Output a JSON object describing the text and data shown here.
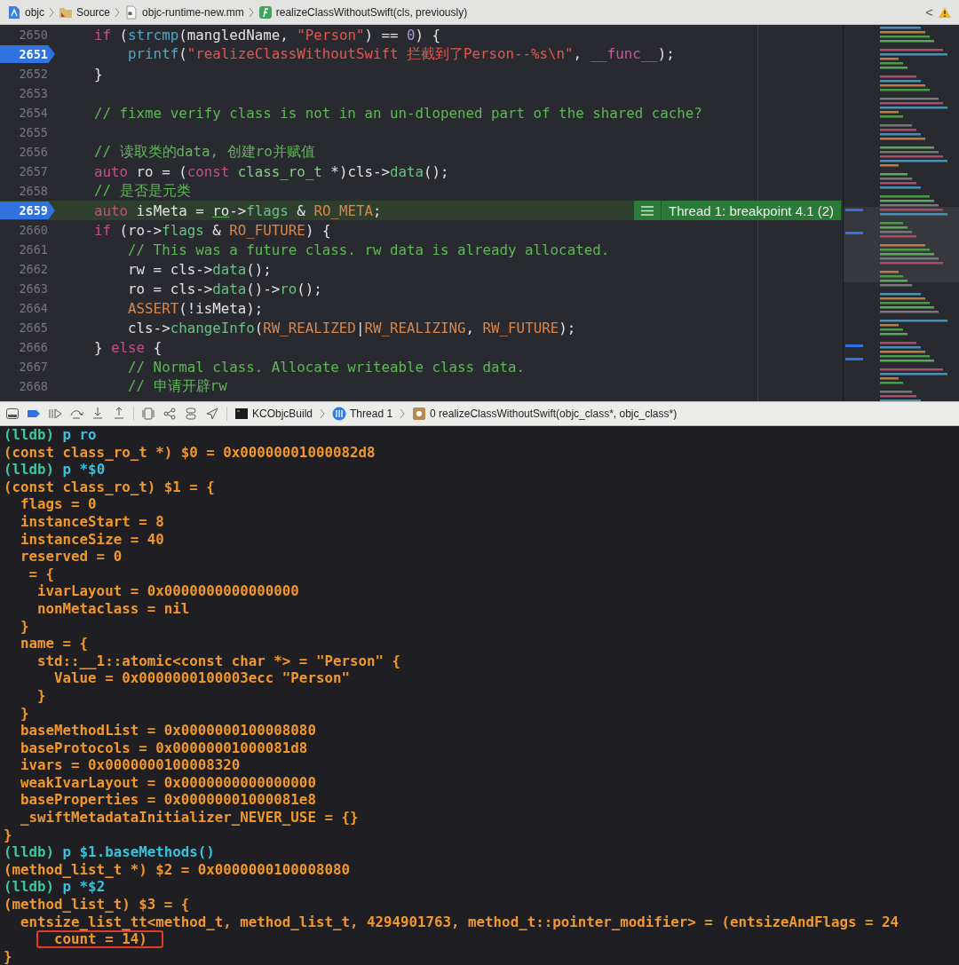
{
  "path_bar": {
    "items": [
      {
        "kind": "project",
        "label": "objc"
      },
      {
        "kind": "folder",
        "label": "Source"
      },
      {
        "kind": "file",
        "label": "objc-runtime-new.mm"
      },
      {
        "kind": "function",
        "label": "realizeClassWithoutSwift(cls, previously)"
      }
    ],
    "back": "<"
  },
  "editor": {
    "lines": [
      {
        "number": "2650",
        "breakpoint": false,
        "current": false,
        "tokens": [
          {
            "kind": "keyword",
            "text": "    if"
          },
          {
            "kind": "plain",
            "text": " ("
          },
          {
            "kind": "function",
            "text": "strcmp"
          },
          {
            "kind": "plain",
            "text": "(mangledName, "
          },
          {
            "kind": "string",
            "text": "\"Person\""
          },
          {
            "kind": "plain",
            "text": ") == "
          },
          {
            "kind": "number",
            "text": "0"
          },
          {
            "kind": "plain",
            "text": ") {"
          }
        ]
      },
      {
        "number": "2651",
        "breakpoint": true,
        "current": false,
        "tokens": [
          {
            "kind": "function",
            "text": "        printf"
          },
          {
            "kind": "plain",
            "text": "("
          },
          {
            "kind": "string",
            "text": "\"realizeClassWithoutSwift 拦截到了Person--%s\\n\""
          },
          {
            "kind": "plain",
            "text": ", "
          },
          {
            "kind": "macro_var",
            "text": "__func__"
          },
          {
            "kind": "plain",
            "text": ");"
          }
        ]
      },
      {
        "number": "2652",
        "breakpoint": false,
        "current": false,
        "tokens": [
          {
            "kind": "plain",
            "text": "    }"
          }
        ]
      },
      {
        "number": "2653",
        "breakpoint": false,
        "current": false
      },
      {
        "number": "2654",
        "breakpoint": false,
        "current": false,
        "tokens": [
          {
            "kind": "comment",
            "text": "    // fixme verify class is not in an un-dlopened part of the shared cache?"
          }
        ]
      },
      {
        "number": "2655",
        "breakpoint": false,
        "current": false
      },
      {
        "number": "2656",
        "breakpoint": false,
        "current": false,
        "tokens": [
          {
            "kind": "comment",
            "text": "    // 读取类的data, 创建ro并赋值"
          }
        ]
      },
      {
        "number": "2657",
        "breakpoint": false,
        "current": false,
        "tokens": [
          {
            "kind": "keyword",
            "text": "    auto"
          },
          {
            "kind": "plain",
            "text": " ro = ("
          },
          {
            "kind": "keyword",
            "text": "const"
          },
          {
            "kind": "type",
            "text": " class_ro_t"
          },
          {
            "kind": "plain",
            "text": " *)cls->"
          },
          {
            "kind": "method",
            "text": "data"
          },
          {
            "kind": "plain",
            "text": "();"
          }
        ]
      },
      {
        "number": "2658",
        "breakpoint": false,
        "current": false,
        "tokens": [
          {
            "kind": "comment",
            "text": "    // 是否是元类"
          }
        ]
      },
      {
        "number": "2659",
        "breakpoint": true,
        "current": true,
        "annotation": "Thread 1: breakpoint 4.1 (2)",
        "tokens": [
          {
            "kind": "keyword",
            "text": "    auto"
          },
          {
            "kind": "plain",
            "text": " isMeta = "
          },
          {
            "kind": "underlined",
            "text": "ro"
          },
          {
            "kind": "plain",
            "text": "->"
          },
          {
            "kind": "method",
            "text": "flags"
          },
          {
            "kind": "plain",
            "text": " & "
          },
          {
            "kind": "macro",
            "text": "RO_META"
          },
          {
            "kind": "plain",
            "text": ";"
          }
        ]
      },
      {
        "number": "2660",
        "breakpoint": false,
        "current": false,
        "tokens": [
          {
            "kind": "keyword",
            "text": "    if"
          },
          {
            "kind": "plain",
            "text": " (ro->"
          },
          {
            "kind": "method",
            "text": "flags"
          },
          {
            "kind": "plain",
            "text": " & "
          },
          {
            "kind": "macro",
            "text": "RO_FUTURE"
          },
          {
            "kind": "plain",
            "text": ") {"
          }
        ]
      },
      {
        "number": "2661",
        "breakpoint": false,
        "current": false,
        "tokens": [
          {
            "kind": "comment",
            "text": "        // This was a future class. rw data is already allocated."
          }
        ]
      },
      {
        "number": "2662",
        "breakpoint": false,
        "current": false,
        "tokens": [
          {
            "kind": "plain",
            "text": "        rw = cls->"
          },
          {
            "kind": "method",
            "text": "data"
          },
          {
            "kind": "plain",
            "text": "();"
          }
        ]
      },
      {
        "number": "2663",
        "breakpoint": false,
        "current": false,
        "tokens": [
          {
            "kind": "plain",
            "text": "        ro = cls->"
          },
          {
            "kind": "method",
            "text": "data"
          },
          {
            "kind": "plain",
            "text": "()->"
          },
          {
            "kind": "method",
            "text": "ro"
          },
          {
            "kind": "plain",
            "text": "();"
          }
        ]
      },
      {
        "number": "2664",
        "breakpoint": false,
        "current": false,
        "tokens": [
          {
            "kind": "macro",
            "text": "        ASSERT"
          },
          {
            "kind": "plain",
            "text": "(!isMeta);"
          }
        ]
      },
      {
        "number": "2665",
        "breakpoint": false,
        "current": false,
        "tokens": [
          {
            "kind": "plain",
            "text": "        cls->"
          },
          {
            "kind": "method",
            "text": "changeInfo"
          },
          {
            "kind": "plain",
            "text": "("
          },
          {
            "kind": "macro",
            "text": "RW_REALIZED"
          },
          {
            "kind": "plain",
            "text": "|"
          },
          {
            "kind": "macro",
            "text": "RW_REALIZING"
          },
          {
            "kind": "plain",
            "text": ", "
          },
          {
            "kind": "macro",
            "text": "RW_FUTURE"
          },
          {
            "kind": "plain",
            "text": ");"
          }
        ]
      },
      {
        "number": "2666",
        "breakpoint": false,
        "current": false,
        "tokens": [
          {
            "kind": "plain",
            "text": "    } "
          },
          {
            "kind": "keyword",
            "text": "else"
          },
          {
            "kind": "plain",
            "text": " {"
          }
        ]
      },
      {
        "number": "2667",
        "breakpoint": false,
        "current": false,
        "tokens": [
          {
            "kind": "comment",
            "text": "        // Normal class. Allocate writeable class data."
          }
        ]
      },
      {
        "number": "2668",
        "breakpoint": false,
        "current": false,
        "tokens": [
          {
            "kind": "comment",
            "text": "        // 申请开辟rw"
          }
        ]
      }
    ]
  },
  "debug_bar": {
    "tools": [
      {
        "kind": "console"
      },
      {
        "kind": "breakpoints"
      },
      {
        "kind": "continue"
      },
      {
        "kind": "step_over"
      },
      {
        "kind": "step_into"
      },
      {
        "kind": "step_out"
      },
      {
        "kind": "view_debugger"
      },
      {
        "kind": "memory_graph"
      },
      {
        "kind": "environment"
      },
      {
        "kind": "location"
      }
    ],
    "path": [
      {
        "kind": "target",
        "label": "KCObjcBuild"
      },
      {
        "kind": "thread",
        "label": "Thread 1"
      },
      {
        "kind": "frame",
        "label": "0 realizeClassWithoutSwift(objc_class*, objc_class*)"
      }
    ]
  },
  "console": {
    "lines": [
      {
        "kind": "command",
        "prompt": "(lldb)",
        "text": "p ro"
      },
      {
        "kind": "output",
        "text": "(const class_ro_t *) $0 = 0x00000001000082d8"
      },
      {
        "kind": "command",
        "prompt": "(lldb)",
        "text": "p *$0"
      },
      {
        "kind": "output",
        "text": "(const class_ro_t) $1 = {"
      },
      {
        "kind": "output",
        "text": "  flags = 0"
      },
      {
        "kind": "output",
        "text": "  instanceStart = 8"
      },
      {
        "kind": "output",
        "text": "  instanceSize = 40"
      },
      {
        "kind": "output",
        "text": "  reserved = 0"
      },
      {
        "kind": "output",
        "text": "   = {"
      },
      {
        "kind": "output",
        "text": "    ivarLayout = 0x0000000000000000"
      },
      {
        "kind": "output",
        "text": "    nonMetaclass = nil"
      },
      {
        "kind": "output",
        "text": "  }"
      },
      {
        "kind": "output",
        "text": "  name = {"
      },
      {
        "kind": "output",
        "text": "    std::__1::atomic<const char *> = \"Person\" {"
      },
      {
        "kind": "output",
        "text": "      Value = 0x0000000100003ecc \"Person\""
      },
      {
        "kind": "output",
        "text": "    }"
      },
      {
        "kind": "output",
        "text": "  }"
      },
      {
        "kind": "output",
        "text": "  baseMethodList = 0x0000000100008080"
      },
      {
        "kind": "output",
        "text": "  baseProtocols = 0x00000001000081d8"
      },
      {
        "kind": "output",
        "text": "  ivars = 0x0000000100008320"
      },
      {
        "kind": "output",
        "text": "  weakIvarLayout = 0x0000000000000000"
      },
      {
        "kind": "output",
        "text": "  baseProperties = 0x00000001000081e8"
      },
      {
        "kind": "output",
        "text": "  _swiftMetadataInitializer_NEVER_USE = {}"
      },
      {
        "kind": "output",
        "text": "}"
      },
      {
        "kind": "command",
        "prompt": "(lldb)",
        "text": "p $1.baseMethods()"
      },
      {
        "kind": "output",
        "text": "(method_list_t *) $2 = 0x0000000100008080"
      },
      {
        "kind": "command",
        "prompt": "(lldb)",
        "text": "p *$2"
      },
      {
        "kind": "output",
        "text": "(method_list_t) $3 = {"
      },
      {
        "kind": "output",
        "text": "  entsize_list_tt<method_t, method_list_t, 4294901763, method_t::pointer_modifier> = (entsizeAndFlags = 24"
      },
      {
        "kind": "output",
        "text": "      count = 14)",
        "boxed": true
      },
      {
        "kind": "output",
        "text": "}"
      }
    ]
  }
}
